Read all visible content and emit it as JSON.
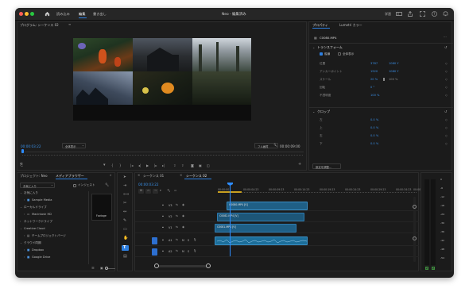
{
  "app": {
    "title": "Neo - 編集済み",
    "tabs": [
      "読み込み",
      "編集",
      "書き出し"
    ],
    "active_tab_index": 1,
    "right_label": "学習"
  },
  "program_monitor": {
    "tab_label": "プログラム: シーケンス 02",
    "timecode_current": "00:00:03:22",
    "fit_label": "全体表示",
    "quality_label": "フル画質",
    "timecode_total": "00:00:09:00"
  },
  "effect_controls": {
    "tab_label": "プロパティ",
    "tab2_label": "Lumetri カラー",
    "clip_name": "C0080.MP4",
    "transform_heading": "トランスフォーム",
    "transform_rows": [
      {
        "label": "",
        "v1": "縦横",
        "v2": "全体表示"
      },
      {
        "label": "位置",
        "v1": "3787",
        "v2": "1080 Y"
      },
      {
        "label": "アンカーポイント",
        "v1": "1920",
        "v2": "1080 Y"
      },
      {
        "label": "スケール",
        "v1": "20 %",
        "v2": "100 %"
      },
      {
        "label": "回転",
        "v1": "0 °",
        "v2": ""
      },
      {
        "label": "不透明度",
        "v1": "100 %",
        "v2": ""
      }
    ],
    "crop_heading": "クロップ",
    "crop_rows": [
      {
        "label": "左",
        "v1": "0.0 %"
      },
      {
        "label": "上",
        "v1": "0.0 %"
      },
      {
        "label": "右",
        "v1": "0.0 %"
      },
      {
        "label": "下",
        "v1": "0.0 %"
      }
    ],
    "footer_button": "設定を調整..."
  },
  "project": {
    "tab_label": "プロジェクト: Neo",
    "tab2_label": "メディアブラウザー",
    "dropdown_label": "お気に入り",
    "ingest_label": "インジェスト",
    "tree": [
      {
        "label": "お気に入り",
        "indent": 0
      },
      {
        "label": "Sample Media",
        "indent": 1
      },
      {
        "label": "ローカルドライブ",
        "indent": 0
      },
      {
        "label": "Macintosh HD",
        "indent": 1
      },
      {
        "label": "ネットワークドライブ",
        "indent": 0
      },
      {
        "label": "Creative Cloud",
        "indent": 0
      },
      {
        "label": "チームプロジェクトバージ",
        "indent": 1
      },
      {
        "label": "クラウド同期",
        "indent": 0
      },
      {
        "label": "Dropbox",
        "indent": 1
      },
      {
        "label": "Google Drive",
        "indent": 1
      }
    ],
    "footage_label": "Footage"
  },
  "timeline": {
    "tabs": [
      "シーケンス 01",
      "シーケンス 02"
    ],
    "active_tab_index": 1,
    "timecode": "00:00:03:22",
    "ruler": [
      "00:00:00",
      "00:00:04:23",
      "00:00:09:23",
      "00:00:14:23",
      "00:00:19:23",
      "00:00:24:23",
      "00:00:29:23",
      "00:00:34:23",
      "00:00:"
    ],
    "tracks": [
      {
        "name": "V3"
      },
      {
        "name": "V2"
      },
      {
        "name": "V1"
      },
      {
        "name": "A1"
      },
      {
        "name": "A2"
      }
    ],
    "clips": [
      {
        "label": "C0080.MP4 [V]",
        "track": "V3"
      },
      {
        "label": "C0082.MP4 [V]",
        "track": "V2"
      },
      {
        "label": "C0081.MP4 [V]",
        "track": "V1"
      }
    ]
  },
  "audio_meter": {
    "scale": [
      "0",
      "-6",
      "-12",
      "-18",
      "-24",
      "-30",
      "-36",
      "-42",
      "-48",
      "-54"
    ],
    "labels": [
      "S",
      "S"
    ]
  },
  "colors": {
    "accent": "#2d7fe0",
    "clip_video": "#1f5f86",
    "clip_audio": "#1c6e9a",
    "playhead": "#2d8cff"
  }
}
